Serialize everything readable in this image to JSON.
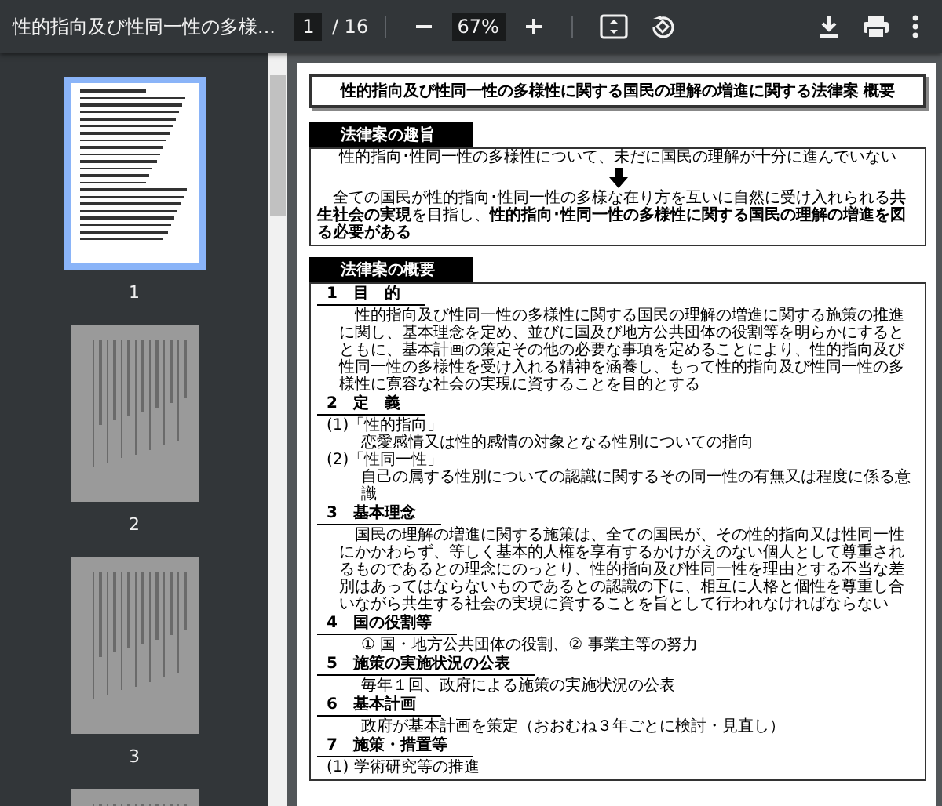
{
  "toolbar": {
    "title": "性的指向及び性同一性の多様...",
    "page": "1",
    "page_total": "/ 16",
    "zoom": "67%"
  },
  "thumbnails": [
    {
      "label": "1",
      "selected": true,
      "kind": "horizontal"
    },
    {
      "label": "2",
      "selected": false,
      "kind": "vertical"
    },
    {
      "label": "3",
      "selected": false,
      "kind": "vertical"
    },
    {
      "selected": false,
      "kind": "vertical"
    }
  ],
  "document": {
    "title": "性的指向及び性同一性の多様性に関する国民の理解の増進に関する法律案 概要",
    "purpose": {
      "heading": "法律案の趣旨",
      "statement": "性的指向･性同一性の多様性について、未だに国民の理解が十分に進んでいない",
      "conclusion": "全ての国民が性的指向･性同一性の多様な在り方を互いに自然に受け入れられる**共生社会の実現**を目指し、**性的指向･性同一性の多様性に関する国民の理解の増進を図る必要がある**"
    },
    "summary": {
      "heading": "法律案の概要",
      "items": [
        {
          "heading": "1　目　的",
          "lines": [
            {
              "kind": "para",
              "text": "性的指向及び性同一性の多様性に関する国民の理解の増進に関する施策の推進に関し、基本理念を定め、並びに国及び地方公共団体の役割等を明らかにするとともに、基本計画の策定その他の必要な事項を定めることにより、性的指向及び性同一性の多様性を受け入れる精神を涵養し、もって性的指向及び性同一性の多様性に寛容な社会の実現に資することを目的とする"
            }
          ]
        },
        {
          "heading": "2　定　義",
          "lines": [
            {
              "kind": "sub",
              "text": "(1)「性的指向」"
            },
            {
              "kind": "note",
              "text": "恋愛感情又は性的感情の対象となる性別についての指向"
            },
            {
              "kind": "sub",
              "text": "(2)「性同一性」"
            },
            {
              "kind": "note",
              "text": "自己の属する性別についての認識に関するその同一性の有無又は程度に係る意識"
            }
          ]
        },
        {
          "heading": "3　基本理念",
          "lines": [
            {
              "kind": "para",
              "text": "国民の理解の増進に関する施策は、全ての国民が、その性的指向又は性同一性にかかわらず、等しく基本的人権を享有するかけがえのない個人として尊重されるものであるとの理念にのっとり、性的指向及び性同一性を理由とする不当な差別はあってはならないものであるとの認識の下に、相互に人格と個性を尊重し合いながら共生する社会の実現に資することを旨として行われなければならない"
            }
          ]
        },
        {
          "heading": "4　国の役割等",
          "lines": [
            {
              "kind": "note",
              "text": "① 国・地方公共団体の役割、② 事業主等の努力"
            }
          ]
        },
        {
          "heading": "5　施策の実施状況の公表",
          "lines": [
            {
              "kind": "note",
              "text": "毎年１回、政府による施策の実施状況の公表"
            }
          ]
        },
        {
          "heading": "6　基本計画",
          "lines": [
            {
              "kind": "note",
              "text": "政府が基本計画を策定（おおむね３年ごとに検討・見直し）"
            }
          ]
        },
        {
          "heading": "7　施策・措置等",
          "lines": [
            {
              "kind": "sub",
              "text": "(1) 学術研究等の推進"
            }
          ]
        }
      ]
    }
  }
}
